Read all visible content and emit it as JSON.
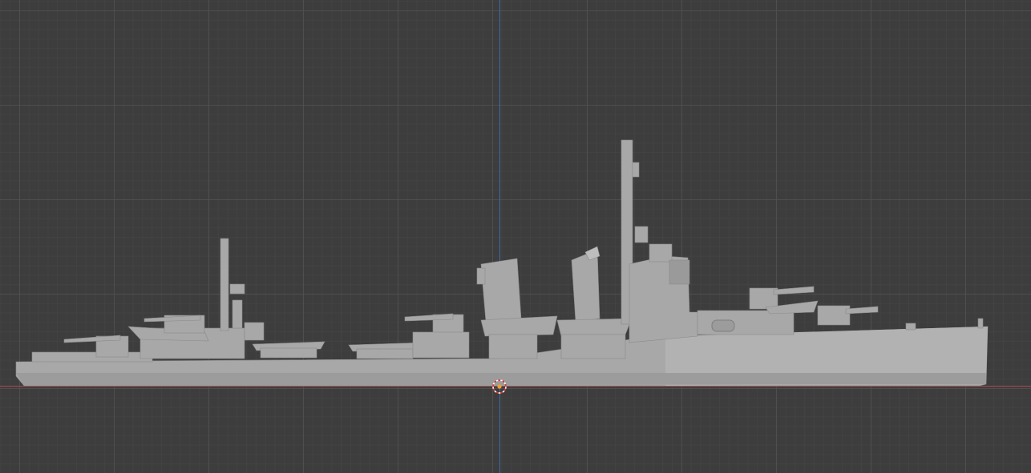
{
  "viewport": {
    "background_color": "#3d3d3d",
    "grid_color": "#505050",
    "axis_x_color": "#b0464c",
    "axis_z_color": "#3d6ab0",
    "model_color": "#a8a8a8",
    "model_shade_color": "#8e8e8e",
    "model_highlight_color": "#bdbdbd"
  },
  "scene_object": {
    "name": "",
    "icon": "destroyer-ship-model"
  },
  "cursor": {
    "icon": "3d-cursor-icon"
  }
}
